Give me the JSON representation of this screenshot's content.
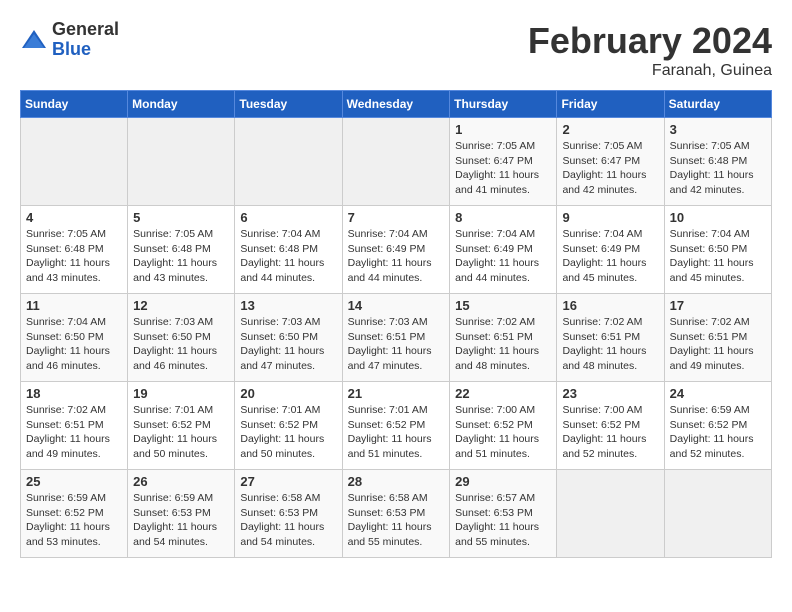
{
  "header": {
    "logo_general": "General",
    "logo_blue": "Blue",
    "month_year": "February 2024",
    "location": "Faranah, Guinea"
  },
  "days_of_week": [
    "Sunday",
    "Monday",
    "Tuesday",
    "Wednesday",
    "Thursday",
    "Friday",
    "Saturday"
  ],
  "weeks": [
    [
      {
        "day": "",
        "sunrise": "",
        "sunset": "",
        "daylight": ""
      },
      {
        "day": "",
        "sunrise": "",
        "sunset": "",
        "daylight": ""
      },
      {
        "day": "",
        "sunrise": "",
        "sunset": "",
        "daylight": ""
      },
      {
        "day": "",
        "sunrise": "",
        "sunset": "",
        "daylight": ""
      },
      {
        "day": "1",
        "sunrise": "7:05 AM",
        "sunset": "6:47 PM",
        "daylight": "11 hours and 41 minutes."
      },
      {
        "day": "2",
        "sunrise": "7:05 AM",
        "sunset": "6:47 PM",
        "daylight": "11 hours and 42 minutes."
      },
      {
        "day": "3",
        "sunrise": "7:05 AM",
        "sunset": "6:48 PM",
        "daylight": "11 hours and 42 minutes."
      }
    ],
    [
      {
        "day": "4",
        "sunrise": "7:05 AM",
        "sunset": "6:48 PM",
        "daylight": "11 hours and 43 minutes."
      },
      {
        "day": "5",
        "sunrise": "7:05 AM",
        "sunset": "6:48 PM",
        "daylight": "11 hours and 43 minutes."
      },
      {
        "day": "6",
        "sunrise": "7:04 AM",
        "sunset": "6:48 PM",
        "daylight": "11 hours and 44 minutes."
      },
      {
        "day": "7",
        "sunrise": "7:04 AM",
        "sunset": "6:49 PM",
        "daylight": "11 hours and 44 minutes."
      },
      {
        "day": "8",
        "sunrise": "7:04 AM",
        "sunset": "6:49 PM",
        "daylight": "11 hours and 44 minutes."
      },
      {
        "day": "9",
        "sunrise": "7:04 AM",
        "sunset": "6:49 PM",
        "daylight": "11 hours and 45 minutes."
      },
      {
        "day": "10",
        "sunrise": "7:04 AM",
        "sunset": "6:50 PM",
        "daylight": "11 hours and 45 minutes."
      }
    ],
    [
      {
        "day": "11",
        "sunrise": "7:04 AM",
        "sunset": "6:50 PM",
        "daylight": "11 hours and 46 minutes."
      },
      {
        "day": "12",
        "sunrise": "7:03 AM",
        "sunset": "6:50 PM",
        "daylight": "11 hours and 46 minutes."
      },
      {
        "day": "13",
        "sunrise": "7:03 AM",
        "sunset": "6:50 PM",
        "daylight": "11 hours and 47 minutes."
      },
      {
        "day": "14",
        "sunrise": "7:03 AM",
        "sunset": "6:51 PM",
        "daylight": "11 hours and 47 minutes."
      },
      {
        "day": "15",
        "sunrise": "7:02 AM",
        "sunset": "6:51 PM",
        "daylight": "11 hours and 48 minutes."
      },
      {
        "day": "16",
        "sunrise": "7:02 AM",
        "sunset": "6:51 PM",
        "daylight": "11 hours and 48 minutes."
      },
      {
        "day": "17",
        "sunrise": "7:02 AM",
        "sunset": "6:51 PM",
        "daylight": "11 hours and 49 minutes."
      }
    ],
    [
      {
        "day": "18",
        "sunrise": "7:02 AM",
        "sunset": "6:51 PM",
        "daylight": "11 hours and 49 minutes."
      },
      {
        "day": "19",
        "sunrise": "7:01 AM",
        "sunset": "6:52 PM",
        "daylight": "11 hours and 50 minutes."
      },
      {
        "day": "20",
        "sunrise": "7:01 AM",
        "sunset": "6:52 PM",
        "daylight": "11 hours and 50 minutes."
      },
      {
        "day": "21",
        "sunrise": "7:01 AM",
        "sunset": "6:52 PM",
        "daylight": "11 hours and 51 minutes."
      },
      {
        "day": "22",
        "sunrise": "7:00 AM",
        "sunset": "6:52 PM",
        "daylight": "11 hours and 51 minutes."
      },
      {
        "day": "23",
        "sunrise": "7:00 AM",
        "sunset": "6:52 PM",
        "daylight": "11 hours and 52 minutes."
      },
      {
        "day": "24",
        "sunrise": "6:59 AM",
        "sunset": "6:52 PM",
        "daylight": "11 hours and 52 minutes."
      }
    ],
    [
      {
        "day": "25",
        "sunrise": "6:59 AM",
        "sunset": "6:52 PM",
        "daylight": "11 hours and 53 minutes."
      },
      {
        "day": "26",
        "sunrise": "6:59 AM",
        "sunset": "6:53 PM",
        "daylight": "11 hours and 54 minutes."
      },
      {
        "day": "27",
        "sunrise": "6:58 AM",
        "sunset": "6:53 PM",
        "daylight": "11 hours and 54 minutes."
      },
      {
        "day": "28",
        "sunrise": "6:58 AM",
        "sunset": "6:53 PM",
        "daylight": "11 hours and 55 minutes."
      },
      {
        "day": "29",
        "sunrise": "6:57 AM",
        "sunset": "6:53 PM",
        "daylight": "11 hours and 55 minutes."
      },
      {
        "day": "",
        "sunrise": "",
        "sunset": "",
        "daylight": ""
      },
      {
        "day": "",
        "sunrise": "",
        "sunset": "",
        "daylight": ""
      }
    ]
  ]
}
